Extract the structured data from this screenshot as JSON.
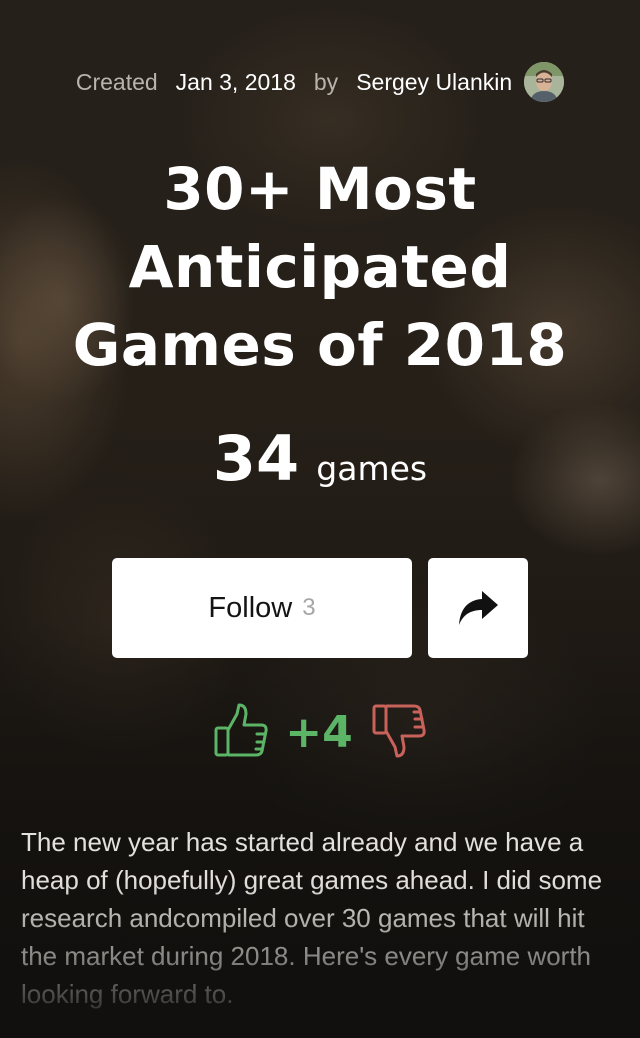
{
  "meta": {
    "created_label": "Created",
    "created_date": "Jan 3, 2018",
    "by_label": "by",
    "author_name": "Sergey Ulankin"
  },
  "collection": {
    "title": "30+ Most Anticipated Games of 2018",
    "games_count": "34",
    "games_unit": "games",
    "description": "The new year has started already and we have a heap of (hopefully) great games ahead. I did some research andcompiled over 30 games that will hit the market during 2018. Here's every game worth looking forward to."
  },
  "actions": {
    "follow_label": "Follow",
    "follow_count": "3"
  },
  "votes": {
    "score": "+4"
  },
  "colors": {
    "upvote": "#5cb567",
    "downvote": "#c8625b"
  },
  "icons": [
    "avatar",
    "share-icon",
    "thumbs-up-icon",
    "thumbs-down-icon"
  ]
}
